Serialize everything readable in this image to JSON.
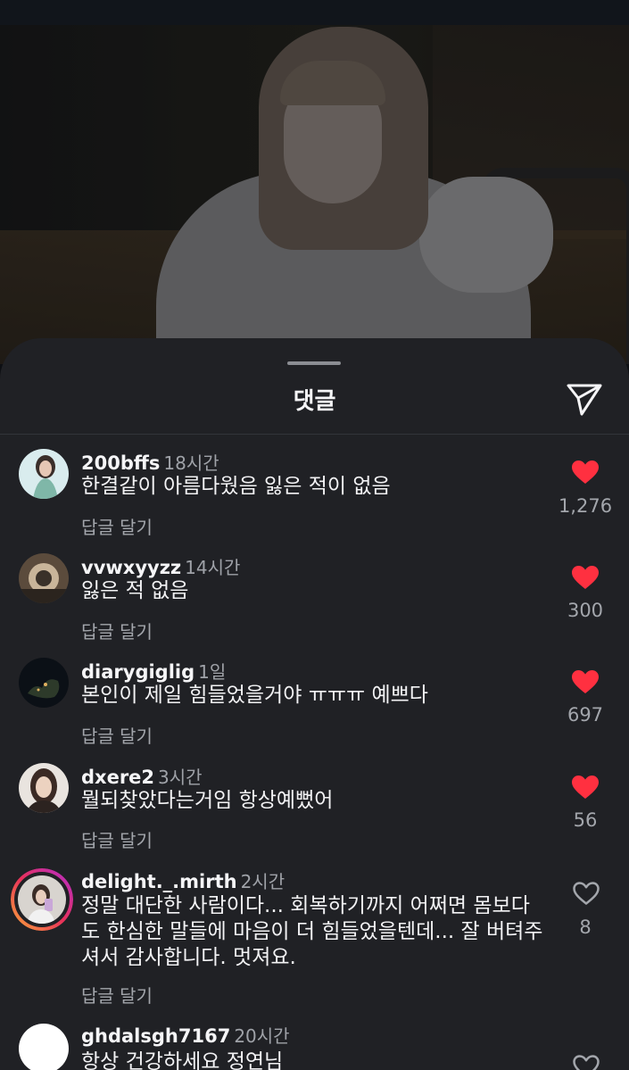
{
  "sheet": {
    "title": "댓글"
  },
  "comments": [
    {
      "user": "200bffs",
      "time": "18시간",
      "text": "한결같이 아름다웠음 잃은 적이 없음",
      "reply": "답글 달기",
      "likes": "1,276",
      "liked": true
    },
    {
      "user": "vvwxyyzz",
      "time": "14시간",
      "text": "잃은 적 없음",
      "reply": "답글 달기",
      "likes": "300",
      "liked": true
    },
    {
      "user": "diarygiglig",
      "time": "1일",
      "text": "본인이 제일 힘들었을거야 ㅠㅠㅠ 예쁘다",
      "reply": "답글 달기",
      "likes": "697",
      "liked": true
    },
    {
      "user": "dxere2",
      "time": "3시간",
      "text": "뭘되찾았다는거임 항상예뻤어",
      "reply": "답글 달기",
      "likes": "56",
      "liked": true
    },
    {
      "user": "delight._.mirth",
      "time": "2시간",
      "text": "정말 대단한 사람이다... 회복하기까지 어쩌면 몸보다 도 한심한 말들에 마음이 더 힘들었을텐데... 잘 버텨주 셔서 감사합니다. 멋져요.",
      "lines": [
        "정말 대단한 사람이다... 회복하기까지 어쩌면 몸보다",
        "도 한심한 말들에 마음이 더 힘들었을텐데... 잘 버텨주",
        "셔서 감사합니다. 멋져요."
      ],
      "reply": "답글 달기",
      "likes": "8",
      "liked": false
    },
    {
      "user": "ghdalsgh7167",
      "time": "20시간",
      "text": "항상 건강하세요 정연님",
      "liked": false
    }
  ],
  "icons": {
    "share": "paper-plane-icon",
    "like_filled": "heart-filled-icon",
    "like_outline": "heart-outline-icon"
  },
  "colors": {
    "like": "#ff3040",
    "sheet_bg": "#202125",
    "muted": "#a3a6ac"
  }
}
